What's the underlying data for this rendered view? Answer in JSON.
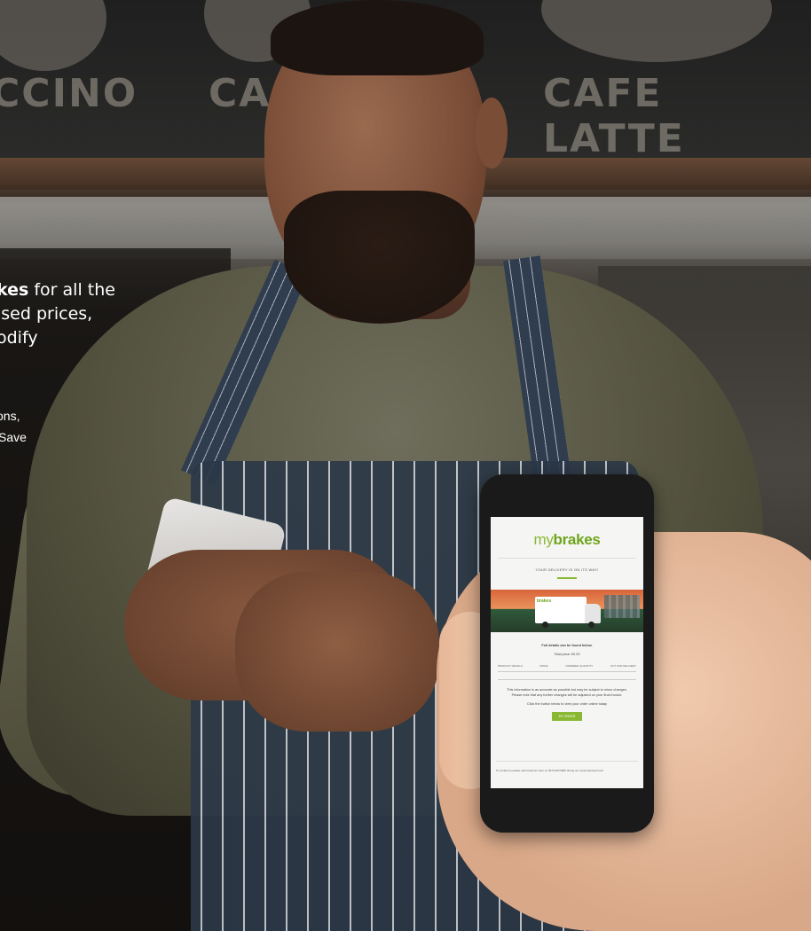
{
  "background": {
    "board_left": "CCINO",
    "board_mid": "CA",
    "board_right": "CAFE LATTE"
  },
  "copy": {
    "line1_bold": "kes",
    "line1_rest": " for all the",
    "line2": "ised prices,",
    "line3": "odify",
    "small1": "ons,",
    "small2": "Save"
  },
  "phone": {
    "logo_prefix": "my",
    "logo_brand": "brakes",
    "delivery_heading": "YOUR DELIVERY IS ON ITS WAY!",
    "truck_brand": "brakes",
    "details_heading": "Full details can be found below.",
    "details_sub": "Total price: £0.00",
    "table_headers": [
      "PRODUCT DETAILS",
      "PRICE",
      "ORDERED QUANTITY",
      "OUT FOR DELIVERY"
    ],
    "info_line1": "This information is as accurate as possible but may be subject to minor changes.",
    "info_line2": "Please note that any further changes will be adjusted on your final invoice.",
    "info_line3": "Click the button below to view your order online today",
    "button_label": "MY ORDER",
    "footer_text": "To contact us please call Customer Care on 0370 000 0000 during our usual opening hours"
  },
  "colors": {
    "brand_green": "#8ab832"
  }
}
